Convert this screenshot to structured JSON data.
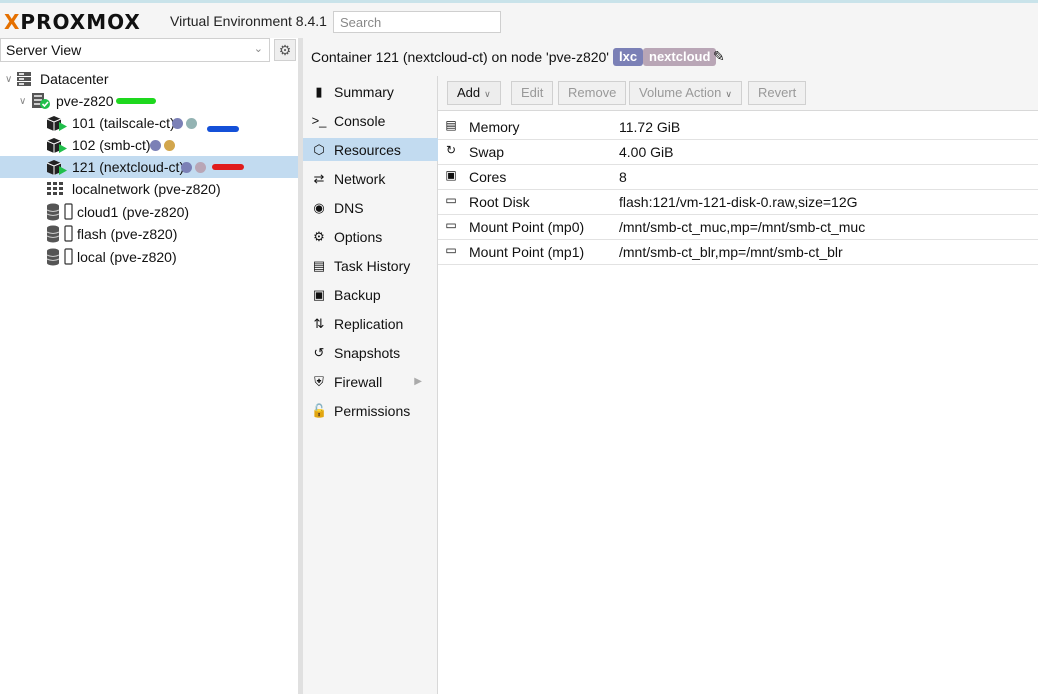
{
  "app": {
    "brand": "PROXMOX",
    "brand_x": "X",
    "title": "Virtual Environment 8.4.1",
    "search_placeholder": "Search"
  },
  "left_panel": {
    "view_select": "Server View",
    "tree": {
      "datacenter": "Datacenter",
      "node": "pve-z820",
      "containers": [
        {
          "label": "101 (tailscale-ct)",
          "tag_colors": [
            "#7b80b6",
            "#93b3b3"
          ]
        },
        {
          "label": "102 (smb-ct)",
          "tag_colors": [
            "#7b80b6",
            "#d2a64d"
          ]
        },
        {
          "label": "121 (nextcloud-ct)",
          "tag_colors": [
            "#7b80b6",
            "#b9a6b6"
          ]
        }
      ],
      "network": "localnetwork (pve-z820)",
      "storages": [
        "cloud1 (pve-z820)",
        "flash (pve-z820)",
        "local (pve-z820)"
      ]
    },
    "highlight_colors": {
      "green": "#1ed81e",
      "blue": "#1450d8",
      "red": "#e01c1c"
    }
  },
  "titlebar": {
    "title": "Container 121 (nextcloud-ct) on node 'pve-z820'",
    "tags": [
      {
        "label": "lxc",
        "color": "#7b80b6"
      },
      {
        "label": "nextcloud",
        "color": "#b9a6b6"
      }
    ]
  },
  "nav": {
    "items": [
      {
        "label": "Summary",
        "icon": "book-icon"
      },
      {
        "label": "Console",
        "icon": "terminal-icon"
      },
      {
        "label": "Resources",
        "icon": "cube-icon"
      },
      {
        "label": "Network",
        "icon": "exchange-icon"
      },
      {
        "label": "DNS",
        "icon": "globe-icon"
      },
      {
        "label": "Options",
        "icon": "gear-icon"
      },
      {
        "label": "Task History",
        "icon": "list-icon"
      },
      {
        "label": "Backup",
        "icon": "floppy-icon"
      },
      {
        "label": "Replication",
        "icon": "retweet-icon"
      },
      {
        "label": "Snapshots",
        "icon": "history-icon"
      },
      {
        "label": "Firewall",
        "icon": "shield-icon"
      },
      {
        "label": "Permissions",
        "icon": "unlock-icon"
      }
    ],
    "active": "Resources"
  },
  "toolbar": {
    "add": "Add",
    "edit": "Edit",
    "remove": "Remove",
    "volume_action": "Volume Action",
    "revert": "Revert"
  },
  "resources": [
    {
      "key": "Memory",
      "value": "11.72 GiB",
      "icon": "memory-icon"
    },
    {
      "key": "Swap",
      "value": "4.00 GiB",
      "icon": "refresh-icon"
    },
    {
      "key": "Cores",
      "value": "8",
      "icon": "cpu-icon"
    },
    {
      "key": "Root Disk",
      "value": "flash:121/vm-121-disk-0.raw,size=12G",
      "icon": "hdd-icon"
    },
    {
      "key": "Mount Point (mp0)",
      "value": "/mnt/smb-ct_muc,mp=/mnt/smb-ct_muc",
      "icon": "hdd-icon"
    },
    {
      "key": "Mount Point (mp1)",
      "value": "/mnt/smb-ct_blr,mp=/mnt/smb-ct_blr",
      "icon": "hdd-icon"
    }
  ]
}
